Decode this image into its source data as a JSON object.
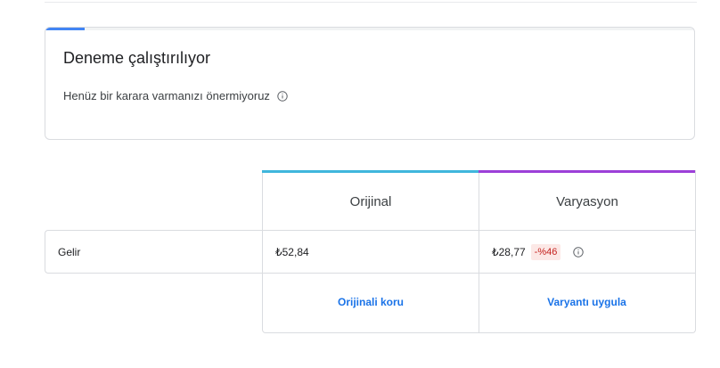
{
  "status_card": {
    "title": "Deneme çalıştırılıyor",
    "subtitle": "Henüz bir karara varmanızı önermiyoruz",
    "progress_fraction": 0.06,
    "progress_color": "#4285f4"
  },
  "comparison": {
    "columns": [
      {
        "label": "Orijinal",
        "accent_color": "#3fb6dc"
      },
      {
        "label": "Varyasyon",
        "accent_color": "#9c3fd8"
      }
    ],
    "rows": [
      {
        "label": "Gelir",
        "original_value": "₺52,84",
        "variant_value": "₺28,77",
        "variant_delta": "-%46"
      }
    ],
    "actions": {
      "keep_original": "Orijinali koru",
      "apply_variant": "Varyantı uygula"
    }
  },
  "icons": {
    "info": "info-icon"
  }
}
